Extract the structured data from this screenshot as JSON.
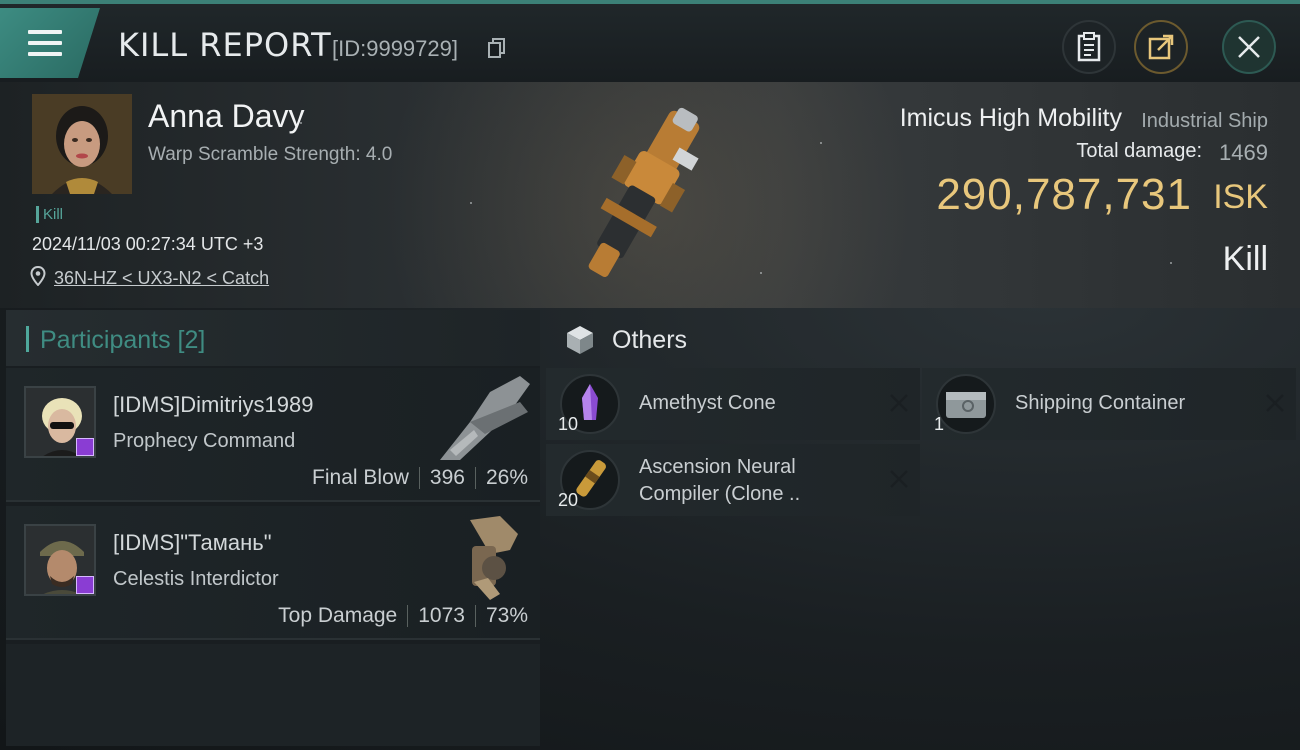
{
  "header": {
    "title": "KILL REPORT",
    "id_text": "[ID:9999729]"
  },
  "victim": {
    "name": "Anna Davy",
    "warp_scramble": "Warp Scramble Strength: 4.0",
    "tag": "Kill",
    "datetime": "2024/11/03 00:27:34 UTC +3",
    "location": "36N-HZ < UX3-N2 < Catch",
    "ship_name": "Imicus High Mobility",
    "ship_class": "Industrial Ship",
    "total_damage_label": "Total damage:",
    "total_damage_value": "1469",
    "isk_value": "290,787,731",
    "isk_unit": "ISK",
    "result": "Kill"
  },
  "participants": {
    "title": "Participants [2]",
    "items": [
      {
        "name": "[IDMS]Dimitriys1989",
        "ship": "Prophecy Command",
        "role": "Final Blow",
        "damage": "396",
        "percent": "26%"
      },
      {
        "name": "[IDMS]\"Тамань\"",
        "ship": "Celestis Interdictor",
        "role": "Top Damage",
        "damage": "1073",
        "percent": "73%"
      }
    ]
  },
  "others": {
    "title": "Others",
    "items": [
      {
        "qty": "10",
        "name": "Amethyst Cone"
      },
      {
        "qty": "1",
        "name": "Shipping Container"
      },
      {
        "qty": "20",
        "name_line1": "Ascension Neural",
        "name_line2": "Compiler (Clone .."
      }
    ]
  },
  "colors": {
    "accent_teal": "#3f8c82",
    "isk_gold": "#e8c77c",
    "badge_purple": "#8a3dd3"
  }
}
